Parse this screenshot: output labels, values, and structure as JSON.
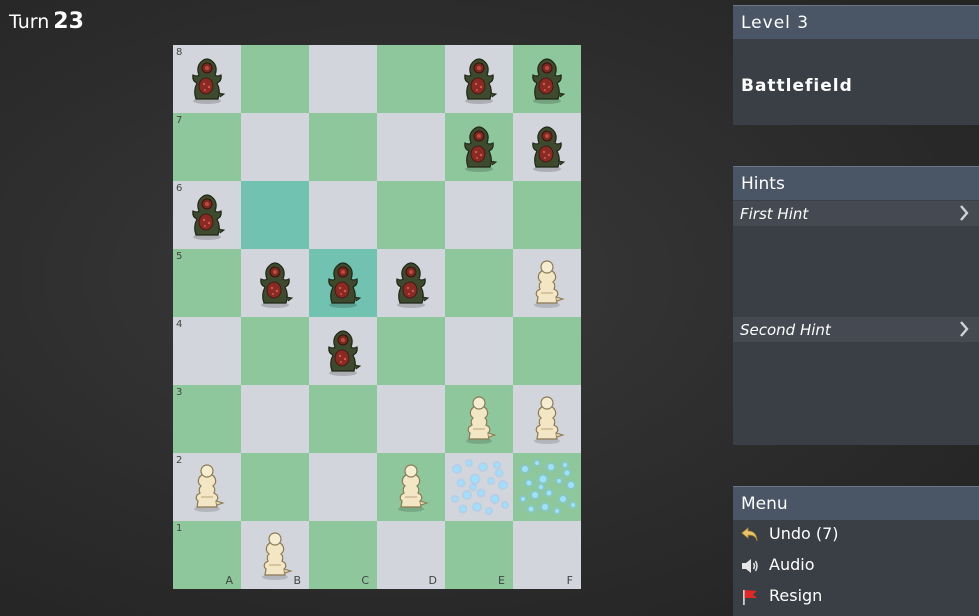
{
  "turn": {
    "label": "Turn",
    "value": "23"
  },
  "level": {
    "title": "Level 3",
    "name": "Battlefield"
  },
  "hints": {
    "header": "Hints",
    "items": [
      {
        "label": "First Hint"
      },
      {
        "label": "Second Hint"
      }
    ]
  },
  "menu": {
    "header": "Menu",
    "items": [
      {
        "label": "Undo (7)",
        "icon": "undo-arrow-icon"
      },
      {
        "label": "Audio",
        "icon": "speaker-icon"
      },
      {
        "label": "Resign",
        "icon": "red-flag-icon"
      }
    ]
  },
  "board": {
    "files": [
      "A",
      "B",
      "C",
      "D",
      "E",
      "F"
    ],
    "ranks": [
      "8",
      "7",
      "6",
      "5",
      "4",
      "3",
      "2",
      "1"
    ],
    "highlighted": [
      "B6",
      "C5"
    ],
    "effects": [
      "E2",
      "F2"
    ],
    "colors": {
      "light": "#d3d5dc",
      "dark": "#8ec79c",
      "highlight": "#71c2b1"
    },
    "pieces": [
      {
        "square": "A8",
        "side": "dark"
      },
      {
        "square": "E8",
        "side": "dark"
      },
      {
        "square": "F8",
        "side": "dark"
      },
      {
        "square": "E7",
        "side": "dark"
      },
      {
        "square": "F7",
        "side": "dark"
      },
      {
        "square": "A6",
        "side": "dark"
      },
      {
        "square": "B5",
        "side": "dark"
      },
      {
        "square": "C5",
        "side": "dark"
      },
      {
        "square": "D5",
        "side": "dark"
      },
      {
        "square": "F5",
        "side": "light"
      },
      {
        "square": "C4",
        "side": "dark"
      },
      {
        "square": "E3",
        "side": "light"
      },
      {
        "square": "F3",
        "side": "light"
      },
      {
        "square": "A2",
        "side": "light"
      },
      {
        "square": "D2",
        "side": "light"
      },
      {
        "square": "B1",
        "side": "light"
      }
    ]
  }
}
